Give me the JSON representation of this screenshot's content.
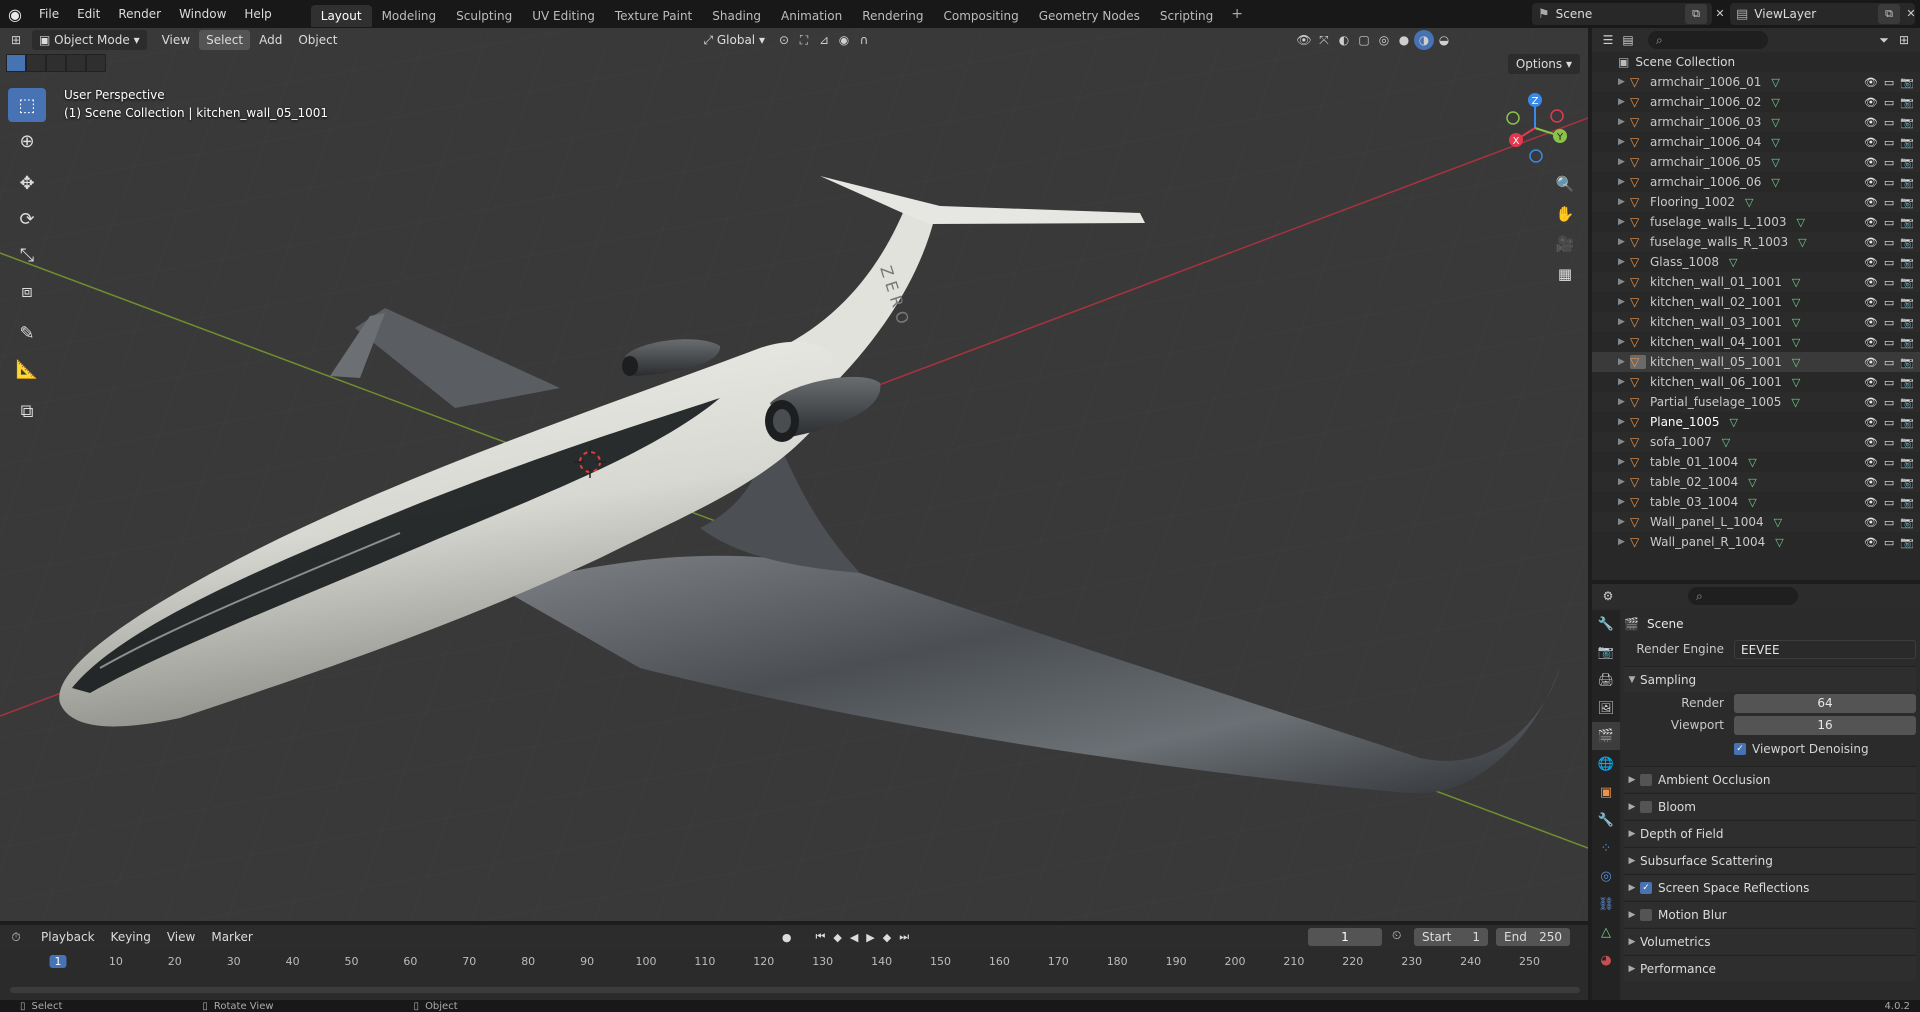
{
  "menu": [
    "File",
    "Edit",
    "Render",
    "Window",
    "Help"
  ],
  "workspaces": [
    "Layout",
    "Modeling",
    "Sculpting",
    "UV Editing",
    "Texture Paint",
    "Shading",
    "Animation",
    "Rendering",
    "Compositing",
    "Geometry Nodes",
    "Scripting"
  ],
  "active_workspace": "Layout",
  "scene_name": "Scene",
  "view_layer": "ViewLayer",
  "viewport": {
    "mode": "Object Mode",
    "menus": [
      "View",
      "Select",
      "Add",
      "Object"
    ],
    "active_menu": "Select",
    "transform_orientation": "Global",
    "info_line1": "User Perspective",
    "info_line2": "(1) Scene Collection | kitchen_wall_05_1001",
    "options_label": "Options",
    "gizmo": {
      "x": "X",
      "y": "Y",
      "z": "Z"
    },
    "tail_text": "Z E R O"
  },
  "outliner": {
    "root": "Scene Collection",
    "items": [
      {
        "name": "armchair_1006_01",
        "state": "normal"
      },
      {
        "name": "armchair_1006_02",
        "state": "normal"
      },
      {
        "name": "armchair_1006_03",
        "state": "normal"
      },
      {
        "name": "armchair_1006_04",
        "state": "normal"
      },
      {
        "name": "armchair_1006_05",
        "state": "normal"
      },
      {
        "name": "armchair_1006_06",
        "state": "normal"
      },
      {
        "name": "Flooring_1002",
        "state": "normal"
      },
      {
        "name": "fuselage_walls_L_1003",
        "state": "normal"
      },
      {
        "name": "fuselage_walls_R_1003",
        "state": "normal"
      },
      {
        "name": "Glass_1008",
        "state": "normal"
      },
      {
        "name": "kitchen_wall_01_1001",
        "state": "normal"
      },
      {
        "name": "kitchen_wall_02_1001",
        "state": "normal"
      },
      {
        "name": "kitchen_wall_03_1001",
        "state": "normal"
      },
      {
        "name": "kitchen_wall_04_1001",
        "state": "normal"
      },
      {
        "name": "kitchen_wall_05_1001",
        "state": "active"
      },
      {
        "name": "kitchen_wall_06_1001",
        "state": "normal"
      },
      {
        "name": "Partial_fuselage_1005",
        "state": "normal"
      },
      {
        "name": "Plane_1005",
        "state": "selected"
      },
      {
        "name": "sofa_1007",
        "state": "normal"
      },
      {
        "name": "table_01_1004",
        "state": "normal"
      },
      {
        "name": "table_02_1004",
        "state": "normal"
      },
      {
        "name": "table_03_1004",
        "state": "normal"
      },
      {
        "name": "Wall_panel_L_1004",
        "state": "normal"
      },
      {
        "name": "Wall_panel_R_1004",
        "state": "normal"
      }
    ]
  },
  "properties": {
    "context": "Scene",
    "render_engine_label": "Render Engine",
    "render_engine": "EEVEE",
    "sampling_label": "Sampling",
    "render_label": "Render",
    "render_samples": "64",
    "viewport_label": "Viewport",
    "viewport_samples": "16",
    "denoising_label": "Viewport Denoising",
    "panels": [
      {
        "label": "Ambient Occlusion",
        "checkbox": true,
        "checked": false
      },
      {
        "label": "Bloom",
        "checkbox": true,
        "checked": false
      },
      {
        "label": "Depth of Field",
        "checkbox": false,
        "checked": false
      },
      {
        "label": "Subsurface Scattering",
        "checkbox": false,
        "checked": false
      },
      {
        "label": "Screen Space Reflections",
        "checkbox": true,
        "checked": true
      },
      {
        "label": "Motion Blur",
        "checkbox": true,
        "checked": false
      },
      {
        "label": "Volumetrics",
        "checkbox": false,
        "checked": false
      },
      {
        "label": "Performance",
        "checkbox": false,
        "checked": false
      }
    ]
  },
  "timeline": {
    "menus": [
      "Playback",
      "Keying",
      "View",
      "Marker"
    ],
    "current_frame": "1",
    "start_label": "Start",
    "start": "1",
    "end_label": "End",
    "end": "250",
    "ticks": [
      "1",
      "10",
      "20",
      "30",
      "40",
      "50",
      "60",
      "70",
      "80",
      "90",
      "100",
      "110",
      "120",
      "130",
      "140",
      "150",
      "160",
      "170",
      "180",
      "190",
      "200",
      "210",
      "220",
      "230",
      "240",
      "250"
    ]
  },
  "status": {
    "select": "Select",
    "rotate": "Rotate View",
    "object": "Object",
    "version": "4.0.2"
  },
  "colors": {
    "accent": "#4772b3",
    "object_icon": "#e8954b",
    "mesh_icon": "#6fd48e",
    "axis_x": "#e2394f",
    "axis_y": "#8bc34a",
    "axis_z": "#3a88e8"
  }
}
